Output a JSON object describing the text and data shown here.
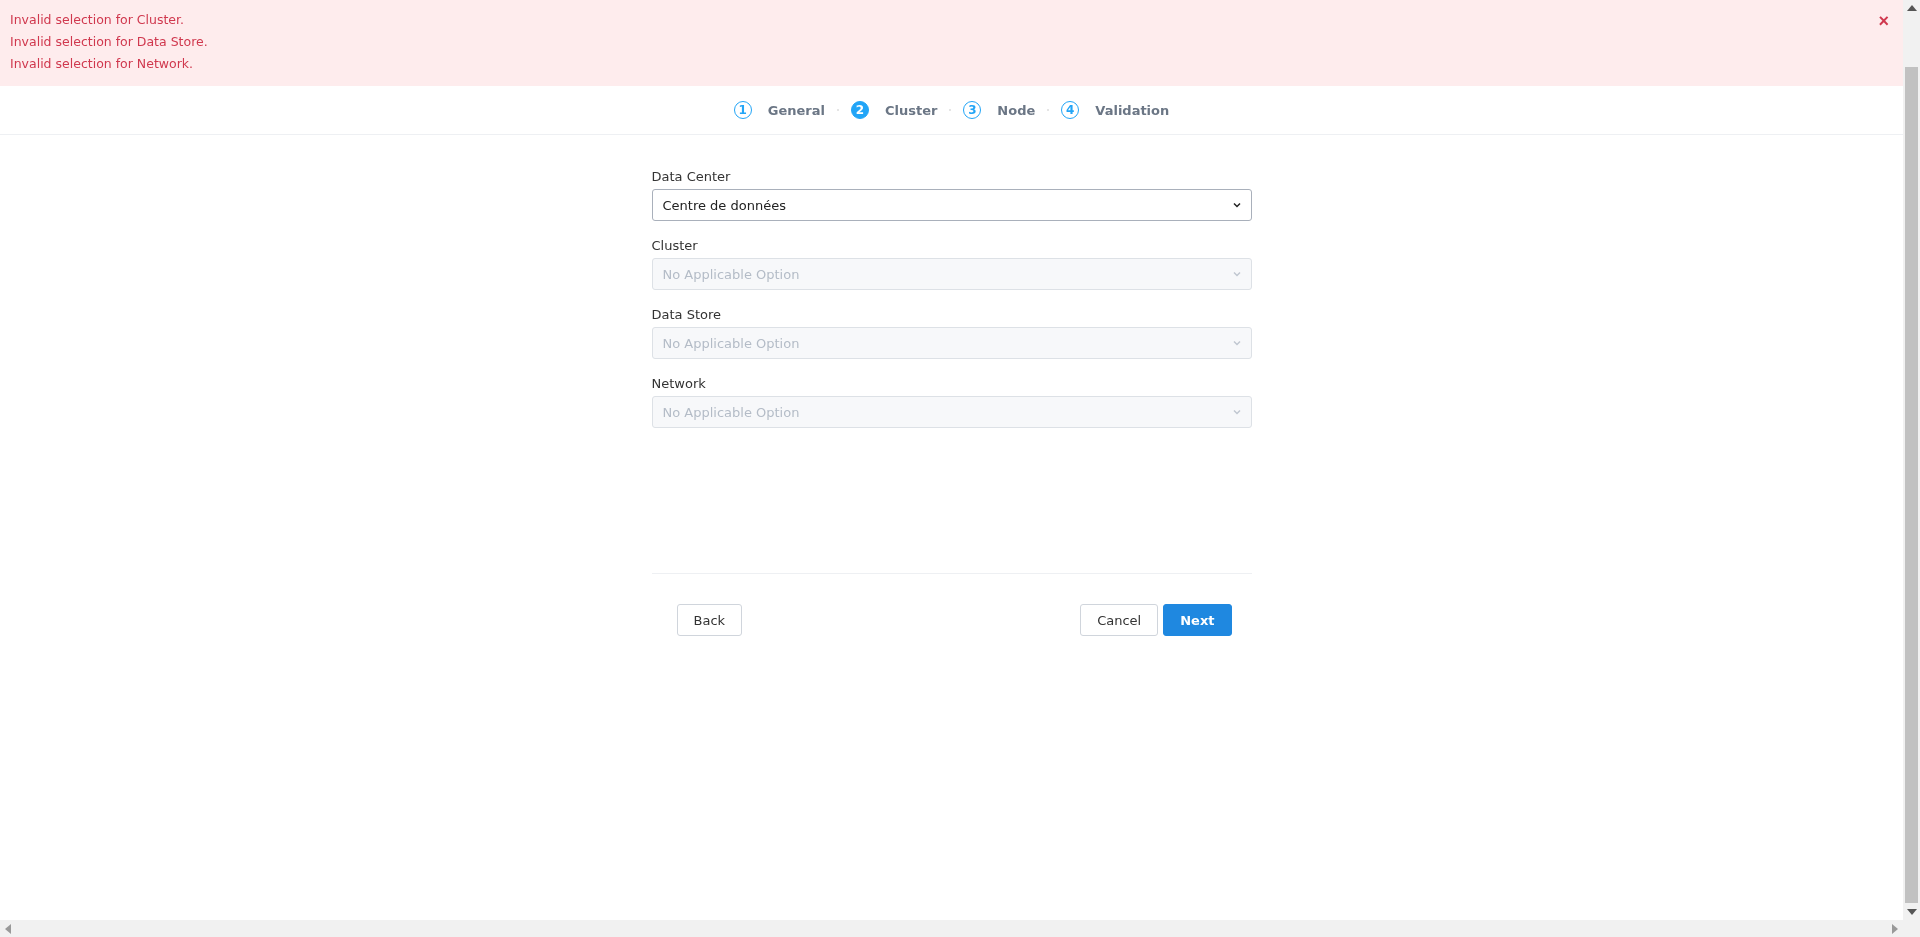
{
  "alert": {
    "messages": [
      "Invalid selection for Cluster.",
      "Invalid selection for Data Store.",
      "Invalid selection for Network."
    ],
    "close": "×"
  },
  "steps": [
    {
      "number": "1",
      "label": "General",
      "selected": false
    },
    {
      "number": "2",
      "label": "Cluster",
      "selected": true
    },
    {
      "number": "3",
      "label": "Node",
      "selected": false
    },
    {
      "number": "4",
      "label": "Validation",
      "selected": false
    }
  ],
  "fields": [
    {
      "label": "Data Center",
      "value": "Centre de données",
      "disabled": false
    },
    {
      "label": "Cluster",
      "value": "No Applicable Option",
      "disabled": true
    },
    {
      "label": "Data Store",
      "value": "No Applicable Option",
      "disabled": true
    },
    {
      "label": "Network",
      "value": "No Applicable Option",
      "disabled": true
    }
  ],
  "buttons": {
    "back": "Back",
    "cancel": "Cancel",
    "next": "Next"
  }
}
